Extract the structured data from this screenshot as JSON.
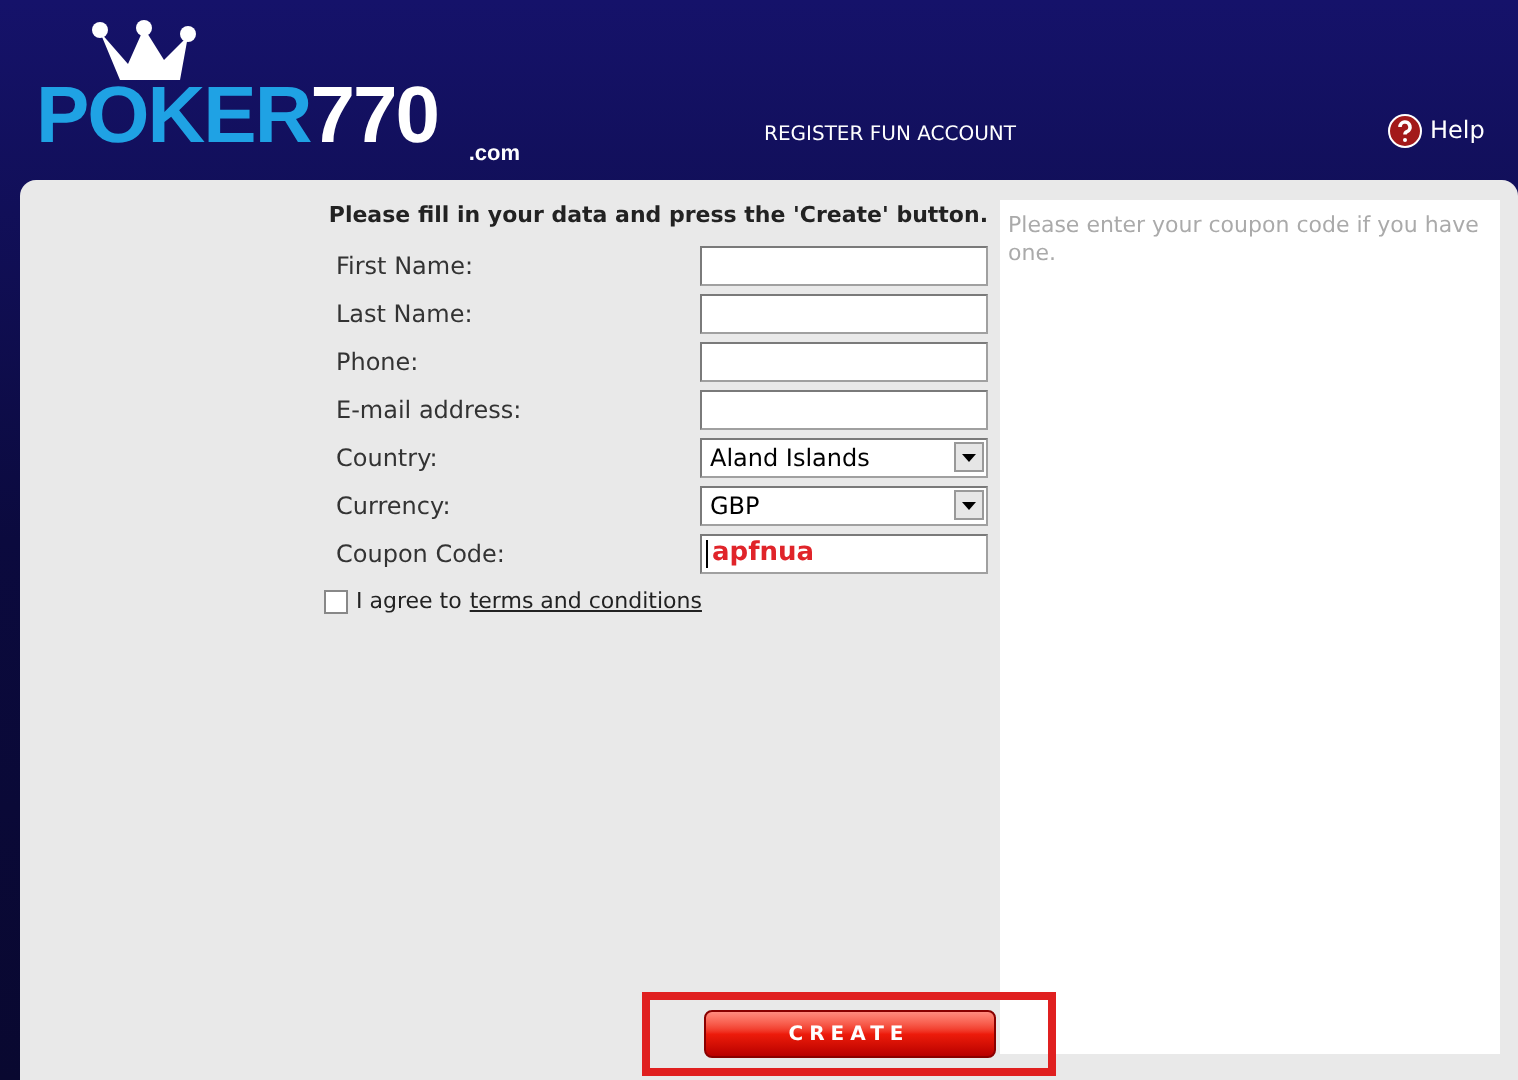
{
  "header": {
    "logo": {
      "word": "POKER",
      "number": "770",
      "domain": ".com"
    },
    "title": "REGISTER FUN ACCOUNT",
    "help": "Help"
  },
  "form": {
    "instruction": "Please fill in your data and press the 'Create' button.",
    "fields": [
      {
        "label": "First Name:",
        "kind": "text"
      },
      {
        "label": "Last Name:",
        "kind": "text"
      },
      {
        "label": "Phone:",
        "kind": "text"
      },
      {
        "label": "E-mail address:",
        "kind": "text"
      },
      {
        "label": "Country:",
        "kind": "select",
        "value": "Aland Islands"
      },
      {
        "label": "Currency:",
        "kind": "select",
        "value": "GBP"
      },
      {
        "label": "Coupon Code:",
        "kind": "coupon",
        "value": "apfnua"
      }
    ],
    "agree": {
      "checked": false,
      "text": "I agree to",
      "link": "terms and conditions"
    }
  },
  "coupon_panel": {
    "placeholder": "Please enter your coupon code if you have one."
  },
  "create_button": {
    "label": "CREATE",
    "highlighted": true
  }
}
